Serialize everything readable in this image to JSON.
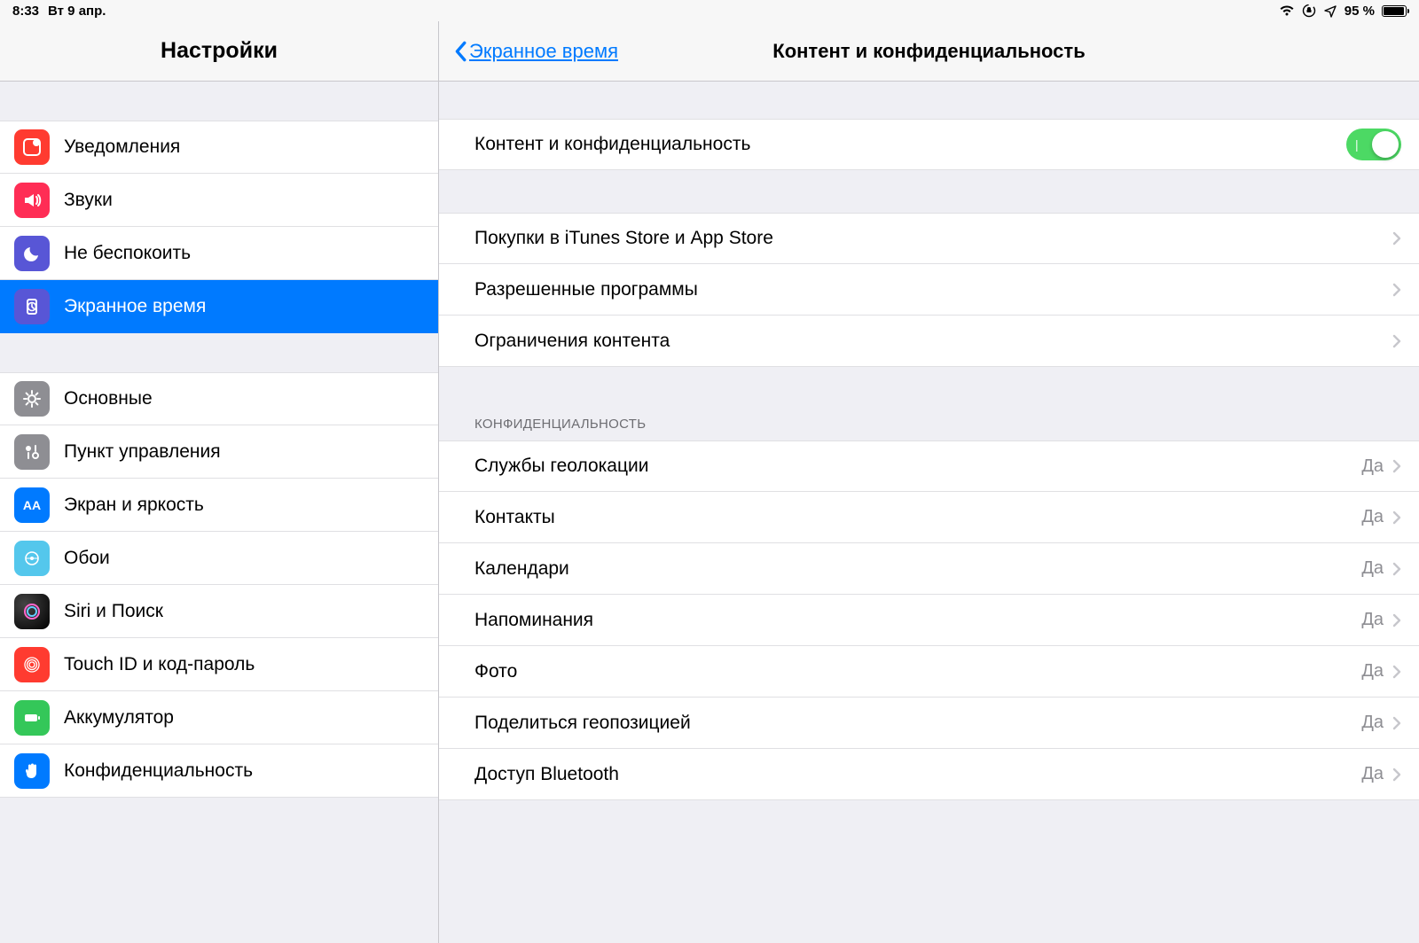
{
  "status": {
    "time": "8:33",
    "date": "Вт 9 апр.",
    "battery_pct": "95 %"
  },
  "sidebar": {
    "title": "Настройки",
    "items": [
      {
        "label": "Уведомления",
        "icon": "notifications",
        "bg": "bg-red"
      },
      {
        "label": "Звуки",
        "icon": "sounds",
        "bg": "bg-pink"
      },
      {
        "label": "Не беспокоить",
        "icon": "dnd",
        "bg": "bg-purple"
      },
      {
        "label": "Экранное время",
        "icon": "screentime",
        "bg": "bg-purple",
        "selected": true
      },
      {
        "label": "Основные",
        "icon": "general",
        "bg": "bg-gray"
      },
      {
        "label": "Пункт управления",
        "icon": "control",
        "bg": "bg-gray"
      },
      {
        "label": "Экран и яркость",
        "icon": "display",
        "bg": "bg-blue"
      },
      {
        "label": "Обои",
        "icon": "wallpaper",
        "bg": "bg-teal"
      },
      {
        "label": "Siri и Поиск",
        "icon": "siri",
        "bg": "bg-black"
      },
      {
        "label": "Touch ID и код-пароль",
        "icon": "touchid",
        "bg": "bg-red"
      },
      {
        "label": "Аккумулятор",
        "icon": "battery",
        "bg": "bg-green"
      },
      {
        "label": "Конфиденциальность",
        "icon": "privacy",
        "bg": "bg-blue"
      }
    ]
  },
  "detail": {
    "back_label": "Экранное время",
    "title": "Контент и конфиденциальность",
    "main_toggle": {
      "label": "Контент и конфиденциальность",
      "on": true
    },
    "group1": [
      {
        "label": "Покупки в iTunes Store и App Store"
      },
      {
        "label": "Разрешенные программы"
      },
      {
        "label": "Ограничения контента"
      }
    ],
    "privacy_header": "КОНФИДЕНЦИАЛЬНОСТЬ",
    "privacy_items": [
      {
        "label": "Службы геолокации",
        "value": "Да"
      },
      {
        "label": "Контакты",
        "value": "Да"
      },
      {
        "label": "Календари",
        "value": "Да"
      },
      {
        "label": "Напоминания",
        "value": "Да"
      },
      {
        "label": "Фото",
        "value": "Да"
      },
      {
        "label": "Поделиться геопозицией",
        "value": "Да"
      },
      {
        "label": "Доступ Bluetooth",
        "value": "Да"
      }
    ]
  }
}
